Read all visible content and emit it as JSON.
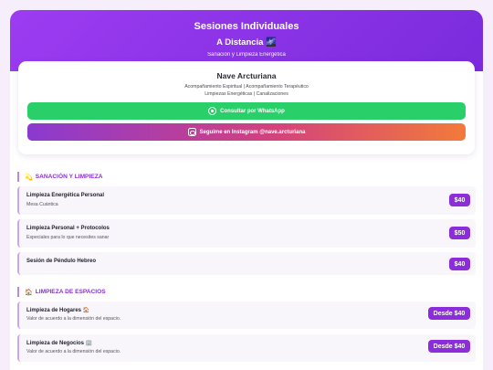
{
  "header": {
    "title": "Sesiones Individuales",
    "subtitle": "A Distancia 🌌",
    "tagline": "Sanación y Limpieza Energética"
  },
  "profile": {
    "name": "Nave Arcturiana",
    "line1": "Acompañamiento Espiritual | Acompañamiento Terapéutico",
    "line2": "Limpiezas Energéticas | Canalizaciones",
    "whatsapp_label": "Consultar por WhatsApp",
    "instagram_label": "Seguime en Instagram @nave.arcturiana"
  },
  "sections": [
    {
      "title": "SANACIÓN Y LIMPIEZA",
      "icon": "💫",
      "items": [
        {
          "name": "Limpieza Energética Personal",
          "desc": "Mesa Cuántica",
          "price": "$40"
        },
        {
          "name": "Limpieza Personal + Protocolos",
          "desc": "Especiales para lo que necesites sanar",
          "price": "$50"
        },
        {
          "name": "Sesión de Péndulo Hebreo",
          "desc": "",
          "price": "$40"
        }
      ]
    },
    {
      "title": "LIMPIEZA DE ESPACIOS",
      "icon": "🏠",
      "items": [
        {
          "name": "Limpieza de Hogares 🏠",
          "desc": "Valor de acuerdo a la dimensión del espacio.",
          "price": "Desde $40"
        },
        {
          "name": "Limpieza de Negocios 🏢",
          "desc": "Valor de acuerdo a la dimensión del espacio.",
          "price": "Desde $40"
        }
      ]
    }
  ],
  "colors": {
    "primary": "#8b2ddb",
    "whatsapp": "#29cf68",
    "instagram_start": "#8a3ad0",
    "instagram_end": "#f37a3a"
  },
  "icons": {
    "whatsapp": "whatsapp-icon",
    "instagram": "instagram-icon"
  }
}
